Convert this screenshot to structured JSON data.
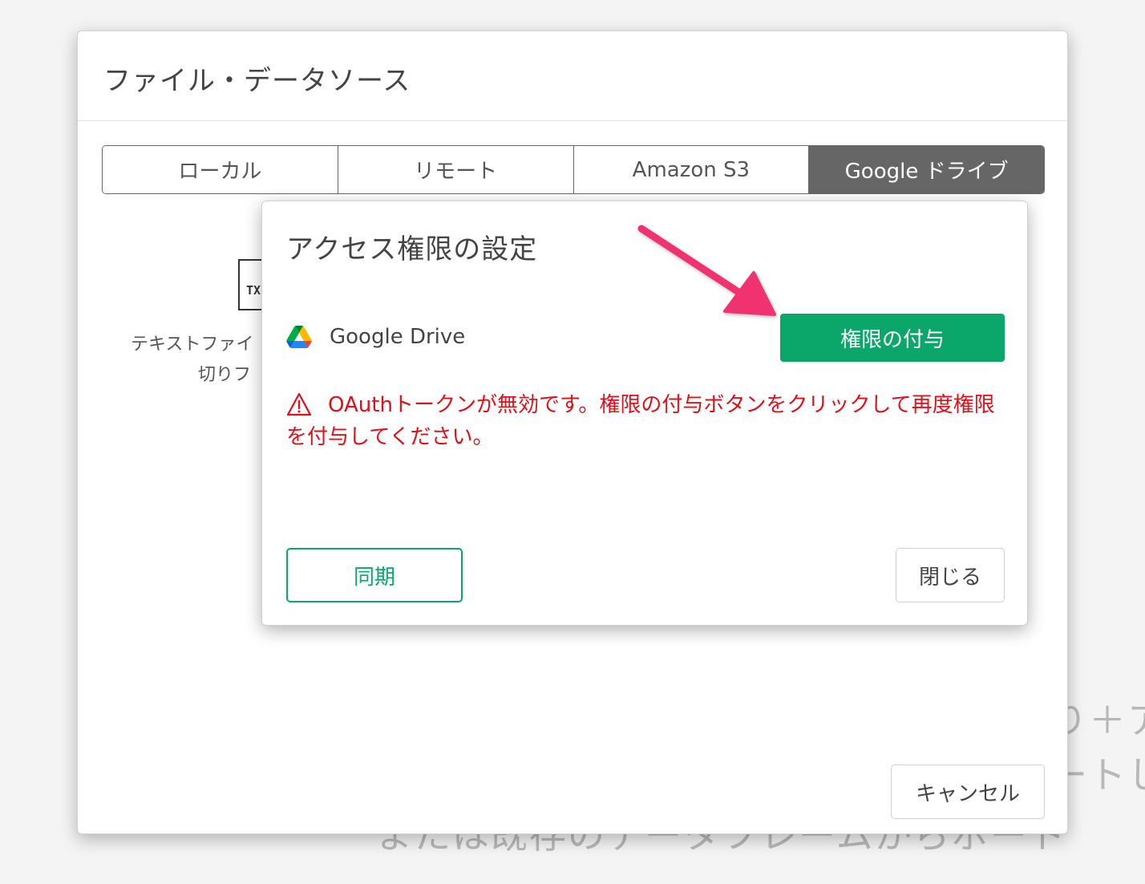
{
  "background": {
    "line1": "り＋ア",
    "line2": "ートし",
    "line3": "または既存のデータフレームからポート"
  },
  "outer_dialog": {
    "title": "ファイル・データソース",
    "tabs": [
      {
        "label": "ローカル",
        "active": false
      },
      {
        "label": "リモート",
        "active": false
      },
      {
        "label": "Amazon S3",
        "active": false
      },
      {
        "label": "Google ドライブ",
        "active": true
      }
    ],
    "file_card": {
      "icon_label": "TX",
      "line1": "テキストファイ",
      "line2": "切りフ"
    },
    "cancel_label": "キャンセル"
  },
  "auth_dialog": {
    "title": "アクセス権限の設定",
    "service_name": "Google Drive",
    "grant_label": "権限の付与",
    "error_message": "OAuthトークンが無効です。権限の付与ボタンをクリックして再度権限を付与してください。",
    "sync_label": "同期",
    "close_label": "閉じる"
  },
  "colors": {
    "accent_green": "#0aa66a",
    "error_red": "#e0101a",
    "arrow_pink": "#f0306f",
    "active_tab": "#666666"
  },
  "icons": {
    "drive": "google-drive-icon",
    "warning": "warning-triangle-icon",
    "annotation": "arrow-annotation"
  }
}
